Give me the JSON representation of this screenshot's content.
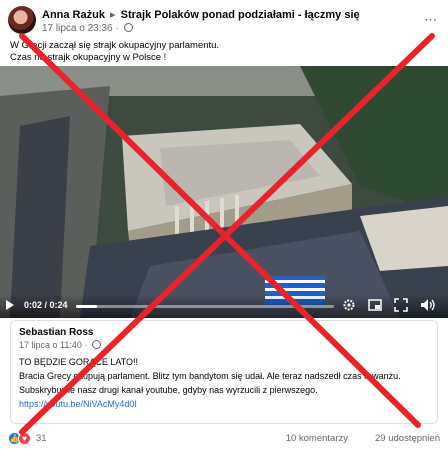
{
  "post": {
    "author": "Anna Rażuk",
    "group": "Strajk Polaków ponad podziałami - łączmy się",
    "timestamp": "17 lipca o 23:36",
    "privacy_icon": "globe-icon",
    "text_line_1": "W Grecji zaczął się strajk okupacyjny parlamentu.",
    "text_line_2": "Czas na strajk okupacyjny w Polsce !"
  },
  "video": {
    "current_time": "0:02",
    "total_time": "0:24",
    "time_display": "0:02 / 0:24",
    "progress_fraction": 0.083
  },
  "shared": {
    "author": "Sebastian Ross",
    "timestamp": "17 lipca o 11:40",
    "line_1": "TO BĘDZIE GORĄCE LATO!!",
    "line_2": "Bracia Grecy okupują parlament. Blitz tym bandytom się udał. Ale teraz nadszedł czas rewanżu.",
    "line_3": "Subskrybujcie nasz drugi kanał youtube, gdyby nas wyrzucili z pierwszego.",
    "link": "https://youtu.be/NiVAcMy4d0I"
  },
  "engagement": {
    "reactions_count": "31",
    "comments": "10 komentarzy",
    "shares": "29 udostępnień"
  },
  "colors": {
    "cross": "#e8232a",
    "link": "#216fdb",
    "like": "#1877f2",
    "love": "#f33e58"
  }
}
